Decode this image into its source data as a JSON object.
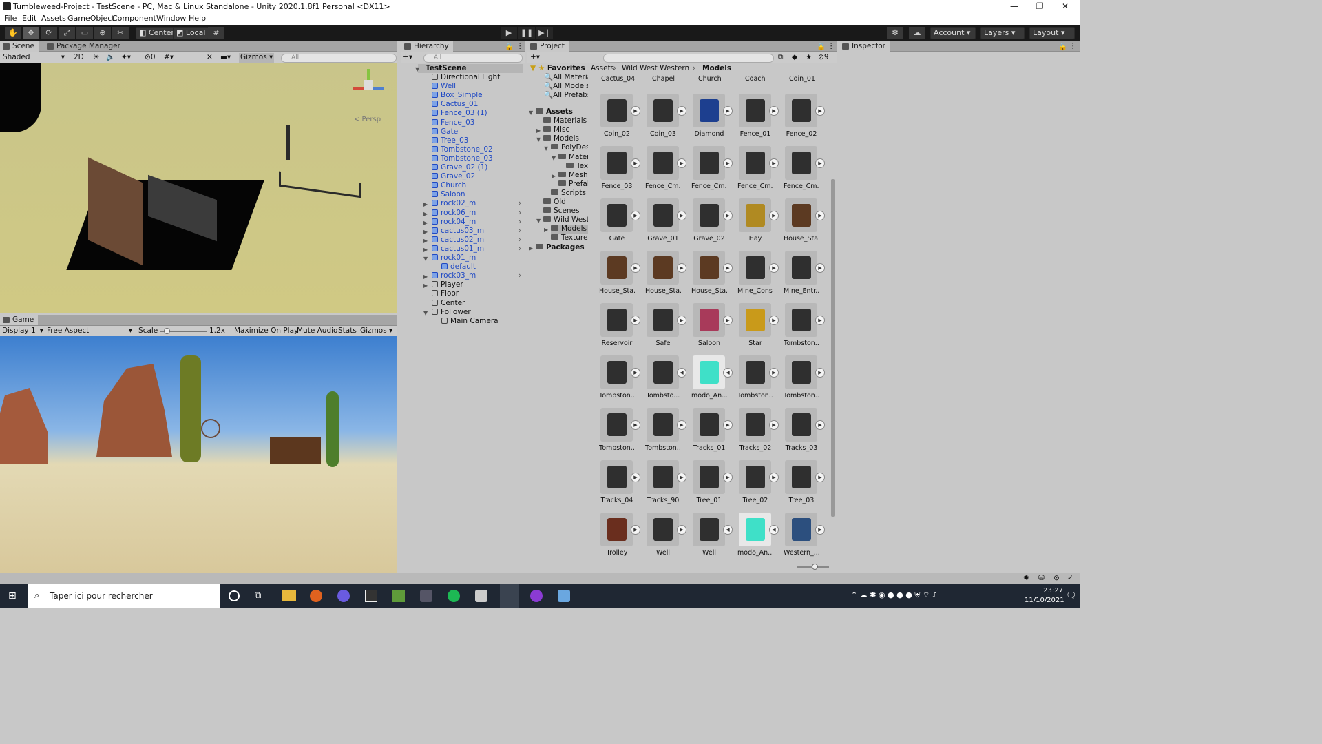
{
  "window": {
    "title": "Tumbleweed-Project - TestScene - PC, Mac & Linux Standalone - Unity 2020.1.8f1 Personal <DX11>",
    "min": "—",
    "max": "❐",
    "close": "✕"
  },
  "menu": [
    "File",
    "Edit",
    "Assets",
    "GameObject",
    "Component",
    "Window",
    "Help"
  ],
  "toolbar": {
    "center": "Center",
    "local": "Local",
    "account": "Account",
    "layers": "Layers",
    "layout": "Layout",
    "play": "▶",
    "pause": "❚❚",
    "step": "▶❘"
  },
  "scene": {
    "tab": "Scene",
    "tab2": "Package Manager",
    "shading": "Shaded",
    "mode2d": "2D",
    "gizmos": "Gizmos",
    "search_placeholder": "All",
    "persp": "< Persp",
    "hidden_count": "0"
  },
  "game": {
    "tab": "Game",
    "display": "Display 1",
    "aspect": "Free Aspect",
    "scale_label": "Scale",
    "scale_value": "1.2x",
    "maximize": "Maximize On Play",
    "mute": "Mute Audio",
    "stats": "Stats",
    "gizmos": "Gizmos"
  },
  "hierarchy": {
    "tab": "Hierarchy",
    "search_placeholder": "All",
    "root": "TestScene",
    "items": [
      {
        "label": "Directional Light",
        "blue": false,
        "indent": 1,
        "arrow": ""
      },
      {
        "label": "Well",
        "blue": true,
        "indent": 1,
        "arrow": ""
      },
      {
        "label": "Box_Simple",
        "blue": true,
        "indent": 1,
        "arrow": ""
      },
      {
        "label": "Cactus_01",
        "blue": true,
        "indent": 1,
        "arrow": ""
      },
      {
        "label": "Fence_03 (1)",
        "blue": true,
        "indent": 1,
        "arrow": ""
      },
      {
        "label": "Fence_03",
        "blue": true,
        "indent": 1,
        "arrow": ""
      },
      {
        "label": "Gate",
        "blue": true,
        "indent": 1,
        "arrow": ""
      },
      {
        "label": "Tree_03",
        "blue": true,
        "indent": 1,
        "arrow": ""
      },
      {
        "label": "Tombstone_02",
        "blue": true,
        "indent": 1,
        "arrow": ""
      },
      {
        "label": "Tombstone_03",
        "blue": true,
        "indent": 1,
        "arrow": ""
      },
      {
        "label": "Grave_02 (1)",
        "blue": true,
        "indent": 1,
        "arrow": ""
      },
      {
        "label": "Grave_02",
        "blue": true,
        "indent": 1,
        "arrow": ""
      },
      {
        "label": "Church",
        "blue": true,
        "indent": 1,
        "arrow": ""
      },
      {
        "label": "Saloon",
        "blue": true,
        "indent": 1,
        "arrow": ""
      },
      {
        "label": "rock02_m",
        "blue": true,
        "indent": 1,
        "arrow": "▶"
      },
      {
        "label": "rock06_m",
        "blue": true,
        "indent": 1,
        "arrow": "▶"
      },
      {
        "label": "rock04_m",
        "blue": true,
        "indent": 1,
        "arrow": "▶"
      },
      {
        "label": "cactus03_m",
        "blue": true,
        "indent": 1,
        "arrow": "▶"
      },
      {
        "label": "cactus02_m",
        "blue": true,
        "indent": 1,
        "arrow": "▶"
      },
      {
        "label": "cactus01_m",
        "blue": true,
        "indent": 1,
        "arrow": "▶"
      },
      {
        "label": "rock01_m",
        "blue": true,
        "indent": 1,
        "arrow": "▼"
      },
      {
        "label": "default",
        "blue": true,
        "indent": 2,
        "arrow": ""
      },
      {
        "label": "rock03_m",
        "blue": true,
        "indent": 1,
        "arrow": "▶"
      },
      {
        "label": "Player",
        "blue": false,
        "indent": 1,
        "arrow": "▶"
      },
      {
        "label": "Floor",
        "blue": false,
        "indent": 1,
        "arrow": ""
      },
      {
        "label": "Center",
        "blue": false,
        "indent": 1,
        "arrow": ""
      },
      {
        "label": "Follower",
        "blue": false,
        "indent": 1,
        "arrow": "▼"
      },
      {
        "label": "Main Camera",
        "blue": false,
        "indent": 2,
        "arrow": ""
      }
    ]
  },
  "project": {
    "tab": "Project",
    "hidden_count": "9",
    "favorites": {
      "label": "Favorites",
      "items": [
        "All Materia",
        "All Models",
        "All Prefabs"
      ]
    },
    "tree": [
      {
        "label": "Assets",
        "indent": 0,
        "arrow": "▼",
        "bold": true
      },
      {
        "label": "Materials",
        "indent": 1,
        "arrow": ""
      },
      {
        "label": "Misc",
        "indent": 1,
        "arrow": "▶"
      },
      {
        "label": "Models",
        "indent": 1,
        "arrow": "▼"
      },
      {
        "label": "PolyDes",
        "indent": 2,
        "arrow": "▼"
      },
      {
        "label": "Mater",
        "indent": 3,
        "arrow": "▼"
      },
      {
        "label": "Tex",
        "indent": 4,
        "arrow": ""
      },
      {
        "label": "Mesh",
        "indent": 3,
        "arrow": "▶"
      },
      {
        "label": "Prefal",
        "indent": 3,
        "arrow": ""
      },
      {
        "label": "Scripts",
        "indent": 2,
        "arrow": ""
      },
      {
        "label": "Old",
        "indent": 1,
        "arrow": ""
      },
      {
        "label": "Scenes",
        "indent": 1,
        "arrow": ""
      },
      {
        "label": "Wild West \\",
        "indent": 1,
        "arrow": "▼"
      },
      {
        "label": "Models",
        "indent": 2,
        "arrow": "▶",
        "selected": true
      },
      {
        "label": "Textures",
        "indent": 2,
        "arrow": ""
      },
      {
        "label": "Packages",
        "indent": 0,
        "arrow": "▶",
        "bold": true
      }
    ],
    "breadcrumb": [
      "Assets",
      "Wild West Western",
      "Models"
    ],
    "top_row": [
      "Cactus_04",
      "Chapel",
      "Church",
      "Coach",
      "Coin_01"
    ],
    "assets": [
      "Coin_02",
      "Coin_03",
      "Diamond",
      "Fence_01",
      "Fence_02",
      "Fence_03",
      "Fence_Cm...",
      "Fence_Cm...",
      "Fence_Cm...",
      "Fence_Cm...",
      "Gate",
      "Grave_01",
      "Grave_02",
      "Hay",
      "House_Sta...",
      "House_Sta...",
      "House_Sta...",
      "House_Sta...",
      "Mine_Cons...",
      "Mine_Entr...",
      "Reservoir",
      "Safe",
      "Saloon",
      "Star",
      "Tombston...",
      "Tombston...",
      "Tombsto...",
      "modo_An...",
      "Tombston...",
      "Tombston...",
      "Tombston...",
      "Tombston...",
      "Tracks_01",
      "Tracks_02",
      "Tracks_03",
      "Tracks_04",
      "Tracks_90",
      "Tree_01",
      "Tree_02",
      "Tree_03",
      "Trolley",
      "Well",
      "Well",
      "modo_An...",
      "Western_..."
    ]
  },
  "inspector": {
    "tab": "Inspector"
  },
  "taskbar": {
    "search": "Taper ici pour rechercher",
    "time": "23:27",
    "date": "11/10/2021"
  }
}
